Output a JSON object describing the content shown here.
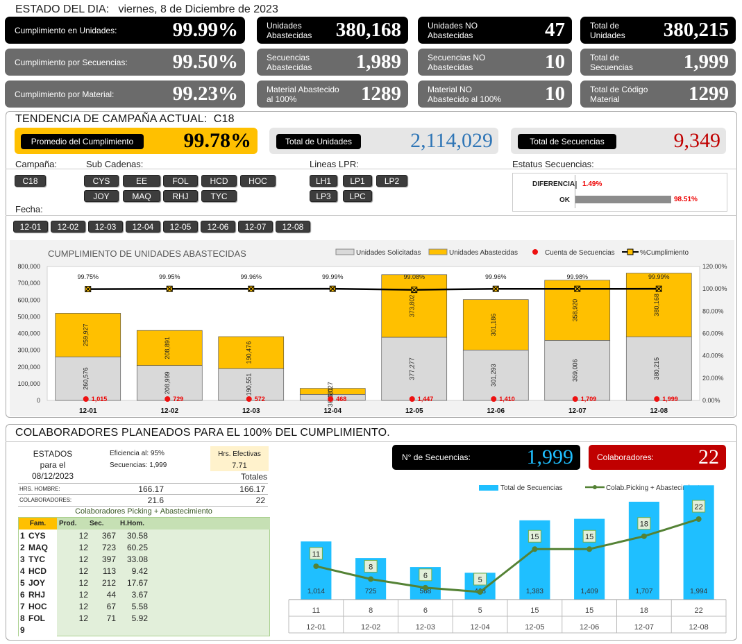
{
  "header": {
    "estado_label": "ESTADO DEL DIA:",
    "date": "viernes, 8 de Diciembre de 2023"
  },
  "kpis": [
    {
      "label": "Cumplimiento en Unidades:",
      "value": "99.99%"
    },
    {
      "label": "Cumplimiento por Secuencias:",
      "value": "99.50%"
    },
    {
      "label": "Cumplimiento por Material:",
      "value": "99.23%"
    },
    {
      "label": "Unidades Abastecidas",
      "value": "380,168"
    },
    {
      "label": "Secuencias Abastecidas",
      "value": "1,989"
    },
    {
      "label": "Material Abastecido al 100%",
      "value": "1289"
    },
    {
      "label": "Unidades NO Abastecidas",
      "value": "47"
    },
    {
      "label": "Secuencias NO Abastecidas",
      "value": "10"
    },
    {
      "label": "Material NO Abastecido al 100%",
      "value": "10"
    },
    {
      "label": "Total de Unidades",
      "value": "380,215"
    },
    {
      "label": "Total de Secuencias",
      "value": "1,999"
    },
    {
      "label": "Total de Código Material",
      "value": "1299"
    }
  ],
  "tendencia": {
    "title": "TENDENCIA DE CAMPAÑA ACTUAL:",
    "campaign": "C18",
    "promedio_label": "Promedio  del Cumplimiento",
    "promedio_value": "99.78%",
    "total_unidades_label": "Total de Unidades",
    "total_unidades_value": "2,114,029",
    "total_secuencias_label": "Total de Secuencias",
    "total_secuencias_value": "9,349"
  },
  "filters": {
    "campana_label": "Campaña:",
    "campana_items": [
      "C18"
    ],
    "subcadenas_label": "Sub Cadenas:",
    "subcadenas_items": [
      "CYS",
      "EE",
      "FOL",
      "HCD",
      "HOC",
      "JOY",
      "MAQ",
      "RHJ",
      "TYC"
    ],
    "lineas_label": "Lineas LPR:",
    "lineas_items": [
      "LH1",
      "LP1",
      "LP2",
      "LP3",
      "LPC"
    ],
    "estatus_label": "Estatus Secuencias:",
    "estatus": [
      {
        "label": "DIFERENCIA",
        "value": "1.49%",
        "pct": 1.49
      },
      {
        "label": "OK",
        "value": "98.51%",
        "pct": 98.51
      }
    ],
    "fecha_label": "Fecha:",
    "fecha_items": [
      "12-01",
      "12-02",
      "12-03",
      "12-04",
      "12-05",
      "12-06",
      "12-07",
      "12-08"
    ]
  },
  "chart_data": [
    {
      "type": "bar",
      "title": "CUMPLIMIENTO DE UNIDADES ABASTECIDAS",
      "categories": [
        "12-01",
        "12-02",
        "12-03",
        "12-04",
        "12-05",
        "12-06",
        "12-07",
        "12-08"
      ],
      "series": [
        {
          "name": "Unidades Solicitadas",
          "values": [
            260576,
            208999,
            190551,
            36081,
            377277,
            301293,
            359006,
            380215
          ],
          "labels": [
            "260,576",
            "208,999",
            "190,551",
            "36,081",
            "377,277",
            "301,293",
            "359,006",
            "380,215"
          ],
          "color": "#d9d9d9"
        },
        {
          "name": "Unidades Abastecidas",
          "values": [
            259927,
            208891,
            190476,
            36027,
            373802,
            301186,
            358920,
            380168
          ],
          "labels": [
            "259,927",
            "208,891",
            "190,476",
            "36,027",
            "373,802",
            "301,186",
            "358,920",
            "380,168"
          ],
          "color": "#ffc000"
        },
        {
          "name": "Cuenta de Secuencias",
          "values": [
            1015,
            729,
            572,
            468,
            1447,
            1410,
            1709,
            1999
          ],
          "labels": [
            "1,015",
            "729",
            "572",
            "468",
            "1,447",
            "1,410",
            "1,709",
            "1,999"
          ],
          "color": "#ee1111"
        },
        {
          "name": "%Cumplimiento",
          "values": [
            99.75,
            99.95,
            99.96,
            99.99,
            99.08,
            99.96,
            99.98,
            99.99
          ],
          "labels": [
            "99.75%",
            "99.95%",
            "99.96%",
            "99.99%",
            "99.08%",
            "99.96%",
            "99.98%",
            "99.99%"
          ],
          "color": "#000000"
        }
      ],
      "yticks": [
        "0",
        "100,000",
        "200,000",
        "300,000",
        "400,000",
        "500,000",
        "600,000",
        "700,000",
        "800,000"
      ],
      "ylim": [
        0,
        800000
      ],
      "y2ticks": [
        "0.00%",
        "20.00%",
        "40.00%",
        "60.00%",
        "80.00%",
        "100.00%",
        "120.00%"
      ],
      "y2lim": [
        0,
        120
      ],
      "legend_position": "top-right",
      "grid": true
    },
    {
      "type": "bar",
      "categories": [
        "12-01",
        "12-02",
        "12-03",
        "12-04",
        "12-05",
        "12-06",
        "12-07",
        "12-08"
      ],
      "series": [
        {
          "name": "Total de Secuencias",
          "values": [
            1014,
            725,
            568,
            468,
            1383,
            1409,
            1707,
            1994
          ],
          "labels": [
            "1,014",
            "725",
            "568",
            "468",
            "1,383",
            "1,409",
            "1,707",
            "1,994"
          ],
          "color": "#1fbfff"
        },
        {
          "name": "Colab.Picking + Abastecimiento",
          "values": [
            11,
            8,
            6,
            5,
            15,
            15,
            18,
            22
          ],
          "labels": [
            "11",
            "8",
            "6",
            "5",
            "15",
            "15",
            "18",
            "22"
          ],
          "color": "#548235"
        }
      ],
      "legend_position": "top",
      "grid": false
    }
  ],
  "colaboradores": {
    "title": "COLABORADORES PLANEADOS PARA EL 100% DEL CUMPLIMIENTO.",
    "estados": [
      "ESTADOS",
      "para el",
      "08/12/2023"
    ],
    "eficiencia": "Eficiencia al:  95%",
    "secuencias": "Secuencias:  1,999",
    "hrs_label": "Hrs. Efectivas",
    "hrs_value": "7.71",
    "totales_label": "Totales",
    "rows": [
      {
        "label": "HRS. HOMBRE:",
        "value": "166.17",
        "total": "166.17"
      },
      {
        "label": "COLABORADORES:",
        "value": "21.6",
        "total": "22"
      }
    ],
    "table_title": "Colaboradores Picking + Abastecimiento",
    "columns": [
      "Fam.",
      "Prod.",
      "Sec.",
      "H.Hom."
    ],
    "table_rows": [
      [
        "1",
        "CYS",
        "12",
        "367",
        "30.58"
      ],
      [
        "2",
        "MAQ",
        "12",
        "723",
        "60.25"
      ],
      [
        "3",
        "TYC",
        "12",
        "397",
        "33.08"
      ],
      [
        "4",
        "HCD",
        "12",
        "113",
        "9.42"
      ],
      [
        "5",
        "JOY",
        "12",
        "212",
        "17.67"
      ],
      [
        "6",
        "RHJ",
        "12",
        "44",
        "3.67"
      ],
      [
        "7",
        "HOC",
        "12",
        "67",
        "5.58"
      ],
      [
        "8",
        "FOL",
        "12",
        "71",
        "5.92"
      ],
      [
        "9",
        "",
        "",
        "",
        ""
      ]
    ],
    "nsec_label": "N° de Secuencias:",
    "nsec_value": "1,999",
    "colab_label": "Colaboradores:",
    "colab_value": "22",
    "bottom_labels": [
      "11",
      "8",
      "6",
      "5",
      "15",
      "15",
      "18",
      "22"
    ]
  },
  "colors": {
    "accent_yellow": "#ffc000",
    "blue": "#2e75b6",
    "red": "#c00000",
    "cyan": "#1fbfff",
    "green": "#548235"
  }
}
